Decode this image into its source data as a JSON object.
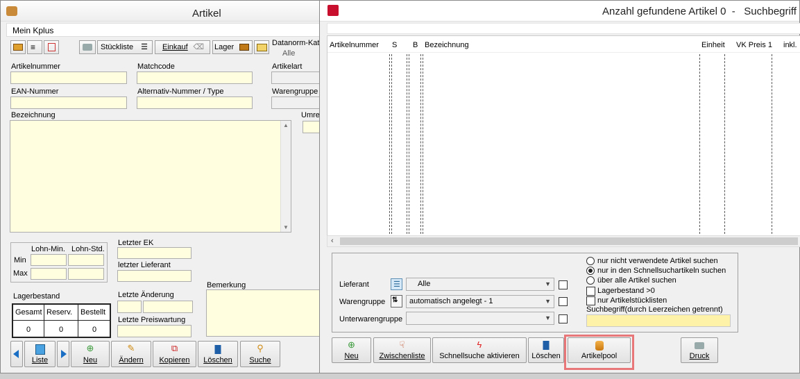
{
  "artikel_window": {
    "title": "Artikel",
    "menu": "Mein Kplus",
    "toolbar": {
      "stueckliste": "Stückliste",
      "einkauf": "Einkauf",
      "lager": "Lager",
      "datanorm_label": "Datanorm-Kata",
      "datanorm_value": "Alle"
    },
    "fields": {
      "artikelnummer": "Artikelnummer",
      "matchcode": "Matchcode",
      "artikelart": "Artikelart",
      "ean": "EAN-Nummer",
      "alternativ": "Alternativ-Nummer / Type",
      "warengruppe": "Warengruppe",
      "bezeichnung": "Bezeichnung",
      "umrec": "Umrec",
      "lohn_min": "Lohn-Min.",
      "lohn_std": "Lohn-Std.",
      "min": "Min",
      "max": "Max",
      "letzter_ek": "Letzter EK",
      "letzter_lieferant": "letzter Lieferant",
      "letzte_aenderung": "Letzte Änderung",
      "letzte_preiswartung": "Letzte Preiswartung",
      "bemerkung": "Bemerkung",
      "lagerbestand": "Lagerbestand"
    },
    "lager_table": {
      "headers": [
        "Gesamt",
        "Reserv.",
        "Bestellt"
      ],
      "values": [
        "0",
        "0",
        "0"
      ]
    },
    "buttons": {
      "liste": "Liste",
      "neu": "Neu",
      "aendern": "Ändern",
      "kopieren": "Kopieren",
      "loeschen": "Löschen",
      "suche": "Suche"
    }
  },
  "search_window": {
    "title": "Anzahl gefundene Artikel 0  -   Suchbegriff",
    "columns": [
      "Artikelnummer",
      "S",
      "B",
      "Bezeichnung",
      "Einheit",
      "VK Preis 1",
      "inkl."
    ],
    "filters": {
      "lieferant_label": "Lieferant",
      "lieferant_value": "Alle",
      "warengruppe_label": "Warengruppe",
      "warengruppe_value": "automatisch angelegt - 1",
      "unterwarengruppe_label": "Unterwarengruppe",
      "unterwarengruppe_value": ""
    },
    "options": {
      "radio1": "nur nicht verwendete Artikel suchen",
      "radio2": "nur in den Schnellsuchartikeln suchen",
      "radio3": "über alle Artikel suchen",
      "check1": "Lagerbestand >0",
      "check2": "nur Artikelstücklisten",
      "suchbegriff_label": "Suchbegriff(durch Leerzeichen getrennt)"
    },
    "buttons": {
      "neu": "Neu",
      "zwischenliste": "Zwischenliste",
      "schnellsuche": "Schnellsuche aktivieren",
      "loeschen": "Löschen",
      "artikelpool": "Artikelpool",
      "druck": "Druck"
    },
    "colors": {
      "highlight": "#e8777a",
      "input_bg": "#ffffe0",
      "suchbegriff_bg": "#fdf2a8"
    }
  }
}
